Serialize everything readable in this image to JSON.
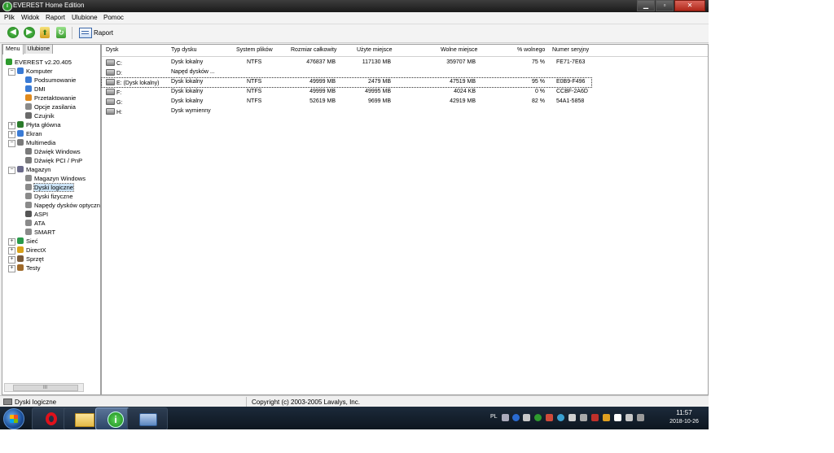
{
  "window": {
    "title": "EVEREST Home Edition",
    "min_glyph": "▁",
    "max_glyph": "▫",
    "close_glyph": "✕",
    "app_icon_glyph": "i"
  },
  "menu": [
    "Plik",
    "Widok",
    "Raport",
    "Ulubione",
    "Pomoc"
  ],
  "toolbar": {
    "report_label": "Raport",
    "back_glyph": "◀",
    "forward_glyph": "▶",
    "up_glyph": "⬆",
    "refresh_glyph": "↻"
  },
  "left_panel": {
    "tabs": [
      "Menu",
      "Ulubione"
    ],
    "tree": [
      {
        "label": "EVEREST v2.20.405",
        "level": 0,
        "icon": "everest-icon",
        "color": "#2e9b2e"
      },
      {
        "label": "Komputer",
        "level": 1,
        "icon": "computer-icon",
        "color": "#3a7bd5",
        "expander": "−"
      },
      {
        "label": "Podsumowanie",
        "level": 2,
        "icon": "computer-icon",
        "color": "#3a7bd5"
      },
      {
        "label": "DMI",
        "level": 2,
        "icon": "computer-icon",
        "color": "#3a7bd5"
      },
      {
        "label": "Przetaktowanie",
        "level": 2,
        "icon": "flame-icon",
        "color": "#e08a1e"
      },
      {
        "label": "Opcje zasilania",
        "level": 2,
        "icon": "power-icon",
        "color": "#8a8a8a"
      },
      {
        "label": "Czujnik",
        "level": 2,
        "icon": "sensor-icon",
        "color": "#6a6a6a"
      },
      {
        "label": "Płyta główna",
        "level": 1,
        "icon": "motherboard-icon",
        "color": "#2a7a2a",
        "expander": "+"
      },
      {
        "label": "Ekran",
        "level": 1,
        "icon": "monitor-icon",
        "color": "#3a7bd5",
        "expander": "+"
      },
      {
        "label": "Multimedia",
        "level": 1,
        "icon": "speaker-icon",
        "color": "#7a7a7a",
        "expander": "−"
      },
      {
        "label": "Dźwięk Windows",
        "level": 2,
        "icon": "speaker-icon",
        "color": "#7a7a7a"
      },
      {
        "label": "Dźwięk PCI / PnP",
        "level": 2,
        "icon": "speaker-icon",
        "color": "#7a7a7a"
      },
      {
        "label": "Magazyn",
        "level": 1,
        "icon": "storage-icon",
        "color": "#6a6a8a",
        "expander": "−"
      },
      {
        "label": "Magazyn Windows",
        "level": 2,
        "icon": "drive-icon",
        "color": "#8a8a8a"
      },
      {
        "label": "Dyski logiczne",
        "level": 2,
        "icon": "drive-icon",
        "color": "#8a8a8a",
        "selected": true
      },
      {
        "label": "Dyski fizyczne",
        "level": 2,
        "icon": "drive-icon",
        "color": "#8a8a8a"
      },
      {
        "label": "Napędy dysków optycznych",
        "level": 2,
        "icon": "optical-drive-icon",
        "color": "#8a8a8a"
      },
      {
        "label": "ASPI",
        "level": 2,
        "icon": "aspi-icon",
        "color": "#555555"
      },
      {
        "label": "ATA",
        "level": 2,
        "icon": "drive-icon",
        "color": "#8a8a8a"
      },
      {
        "label": "SMART",
        "level": 2,
        "icon": "drive-icon",
        "color": "#8a8a8a"
      },
      {
        "label": "Sieć",
        "level": 1,
        "icon": "network-icon",
        "color": "#2a9a4a",
        "expander": "+"
      },
      {
        "label": "DirectX",
        "level": 1,
        "icon": "directx-icon",
        "color": "#d8a21a",
        "expander": "+"
      },
      {
        "label": "Sprzęt",
        "level": 1,
        "icon": "devices-icon",
        "color": "#7a5a3a",
        "expander": "+"
      },
      {
        "label": "Testy",
        "level": 1,
        "icon": "hourglass-icon",
        "color": "#a06a2a",
        "expander": "+"
      }
    ],
    "scroll_grip": "III"
  },
  "table": {
    "columns": [
      "Dysk",
      "Typ dysku",
      "System plików",
      "Rozmiar całkowity",
      "Użyte miejsce",
      "Wolne miejsce",
      "% wolnego",
      "Numer seryjny"
    ],
    "rows": [
      {
        "disk": "C:",
        "type": "Dysk lokalny",
        "fs": "NTFS",
        "total": "476837 MB",
        "used": "117130 MB",
        "free": "359707 MB",
        "pct": "75 %",
        "serial": "FE71-7E63"
      },
      {
        "disk": "D:",
        "type": "Napęd dysków ...",
        "fs": "",
        "total": "",
        "used": "",
        "free": "",
        "pct": "",
        "serial": ""
      },
      {
        "disk": "E: (Dysk lokalny)",
        "type": "Dysk lokalny",
        "fs": "NTFS",
        "total": "49999 MB",
        "used": "2479 MB",
        "free": "47519 MB",
        "pct": "95 %",
        "serial": "E0B9-F496",
        "focus": true
      },
      {
        "disk": "F:",
        "type": "Dysk lokalny",
        "fs": "NTFS",
        "total": "49999 MB",
        "used": "49995 MB",
        "free": "4024 KB",
        "pct": "0 %",
        "serial": "CCBF-2A6D"
      },
      {
        "disk": "G:",
        "type": "Dysk lokalny",
        "fs": "NTFS",
        "total": "52619 MB",
        "used": "9699 MB",
        "free": "42919 MB",
        "pct": "82 %",
        "serial": "54A1-5858"
      },
      {
        "disk": "H:",
        "type": "Dysk wymienny",
        "fs": "",
        "total": "",
        "used": "",
        "free": "",
        "pct": "",
        "serial": ""
      }
    ]
  },
  "status": {
    "left": "Dyski logiczne",
    "copyright": "Copyright (c) 2003-2005 Lavalys, Inc."
  },
  "taskbar": {
    "apps": [
      {
        "name": "opera-browser",
        "active": false
      },
      {
        "name": "file-explorer",
        "active": false
      },
      {
        "name": "everest",
        "active": true,
        "glyph": "i"
      },
      {
        "name": "printer-app",
        "active": false
      }
    ],
    "tray_lang": "PL",
    "time": "11:57",
    "date": "2018-10-26"
  }
}
